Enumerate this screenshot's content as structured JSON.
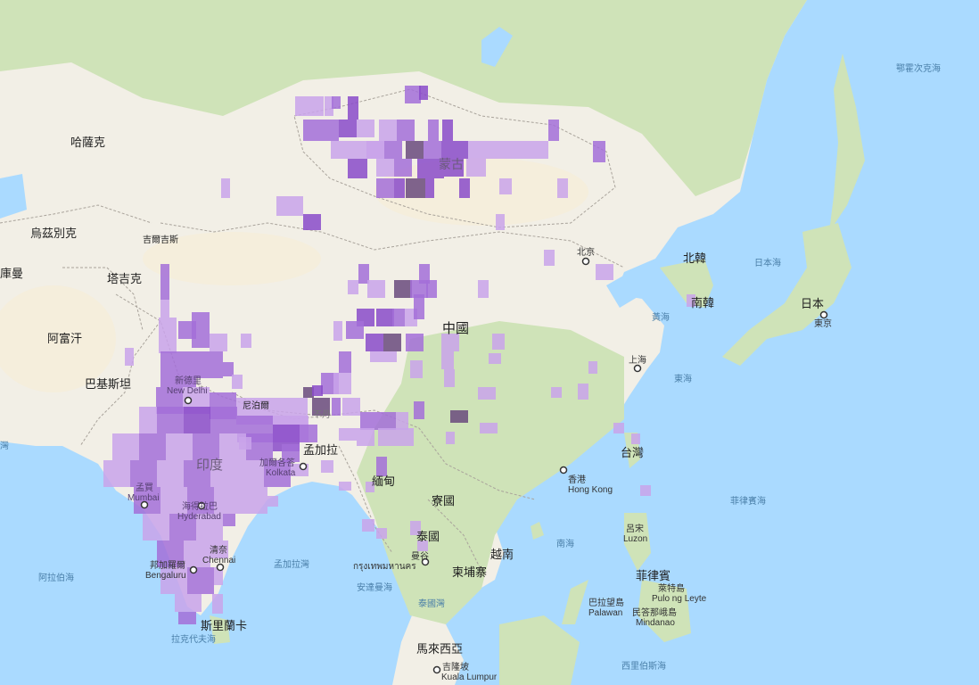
{
  "map": {
    "land_color": "#f2efe6",
    "vegetation_color": "#cfe3b8",
    "desert_color": "#f5eedc",
    "water_color": "#aadaff",
    "border_color": "#a9a39b",
    "cell_palette": [
      "#c9a3ea",
      "#a36fd8",
      "#8a4bc9",
      "#6a4a7c"
    ],
    "countries": [
      {
        "key": "kazakhstan",
        "name": "哈薩克"
      },
      {
        "key": "uzbekistan",
        "name": "烏茲別克"
      },
      {
        "key": "kyrgyzstan",
        "name": "吉爾吉斯"
      },
      {
        "key": "tajikistan",
        "name": "塔吉克"
      },
      {
        "key": "turkmenistan",
        "name": "庫曼"
      },
      {
        "key": "afghanistan",
        "name": "阿富汗"
      },
      {
        "key": "pakistan",
        "name": "巴基斯坦"
      },
      {
        "key": "mongolia",
        "name": "蒙古"
      },
      {
        "key": "china",
        "name": "中國"
      },
      {
        "key": "nepal",
        "name": "尼泊爾"
      },
      {
        "key": "bhutan",
        "name": "不丹"
      },
      {
        "key": "bangladesh",
        "name": "孟加拉"
      },
      {
        "key": "india",
        "name": "印度"
      },
      {
        "key": "myanmar",
        "name": "緬甸"
      },
      {
        "key": "laos",
        "name": "寮國"
      },
      {
        "key": "thailand",
        "name": "泰國"
      },
      {
        "key": "vietnam",
        "name": "越南"
      },
      {
        "key": "cambodia",
        "name": "柬埔寨"
      },
      {
        "key": "malaysia",
        "name": "馬來西亞"
      },
      {
        "key": "srilanka",
        "name": "斯里蘭卡"
      },
      {
        "key": "northkorea",
        "name": "北韓"
      },
      {
        "key": "southkorea",
        "name": "南韓"
      },
      {
        "key": "japan",
        "name": "日本"
      },
      {
        "key": "taiwan",
        "name": "台灣"
      },
      {
        "key": "philippines",
        "name": "菲律賓"
      }
    ],
    "seas": [
      {
        "key": "okhotsk",
        "name": "鄂霍次克海"
      },
      {
        "key": "japan_sea",
        "name": "日本海"
      },
      {
        "key": "yellow_sea",
        "name": "黃海"
      },
      {
        "key": "east_sea",
        "name": "東海"
      },
      {
        "key": "philippine_sea",
        "name": "菲律賓海"
      },
      {
        "key": "south_sea",
        "name": "南海"
      },
      {
        "key": "bay_of_bengal",
        "name": "孟加拉灣"
      },
      {
        "key": "arabian_sea",
        "name": "阿拉伯海"
      },
      {
        "key": "andaman_sea",
        "name": "安達曼海"
      },
      {
        "key": "gulf_thailand",
        "name": "泰國灣"
      },
      {
        "key": "laccadive_sea",
        "name": "拉克代夫海"
      },
      {
        "key": "celebes_sea",
        "name": "西里伯斯海"
      },
      {
        "key": "persian_gulf",
        "name": "灣"
      }
    ],
    "cities": [
      {
        "key": "beijing",
        "name": "北京",
        "latin": ""
      },
      {
        "key": "tokyo",
        "name": "東京",
        "latin": ""
      },
      {
        "key": "shanghai",
        "name": "上海",
        "latin": ""
      },
      {
        "key": "hongkong",
        "name": "香港",
        "latin": "Hong Kong"
      },
      {
        "key": "newdelhi",
        "name": "新德里",
        "latin": "New Delhi"
      },
      {
        "key": "kolkata",
        "name": "加爾各答",
        "latin": "Kolkata"
      },
      {
        "key": "mumbai",
        "name": "孟買",
        "latin": "Mumbai"
      },
      {
        "key": "hyderabad",
        "name": "海得拉巴",
        "latin": "Hyderabad"
      },
      {
        "key": "chennai",
        "name": "清奈",
        "latin": "Chennai"
      },
      {
        "key": "bengaluru",
        "name": "邦加羅爾",
        "latin": "Bengaluru"
      },
      {
        "key": "bangkok",
        "name": "曼谷",
        "latin": "กรุงเทพมหานคร"
      },
      {
        "key": "kualalumpur",
        "name": "吉隆坡",
        "latin": "Kuala Lumpur"
      }
    ],
    "islands": [
      {
        "key": "luzon",
        "name": "呂宋",
        "latin": "Luzon"
      },
      {
        "key": "leyte",
        "name": "萊特島",
        "latin": "Pulo ng Leyte"
      },
      {
        "key": "palawan",
        "name": "巴拉望島",
        "latin": "Palawan"
      },
      {
        "key": "mindanao",
        "name": "民答那峨島",
        "latin": "Mindanao"
      }
    ]
  }
}
